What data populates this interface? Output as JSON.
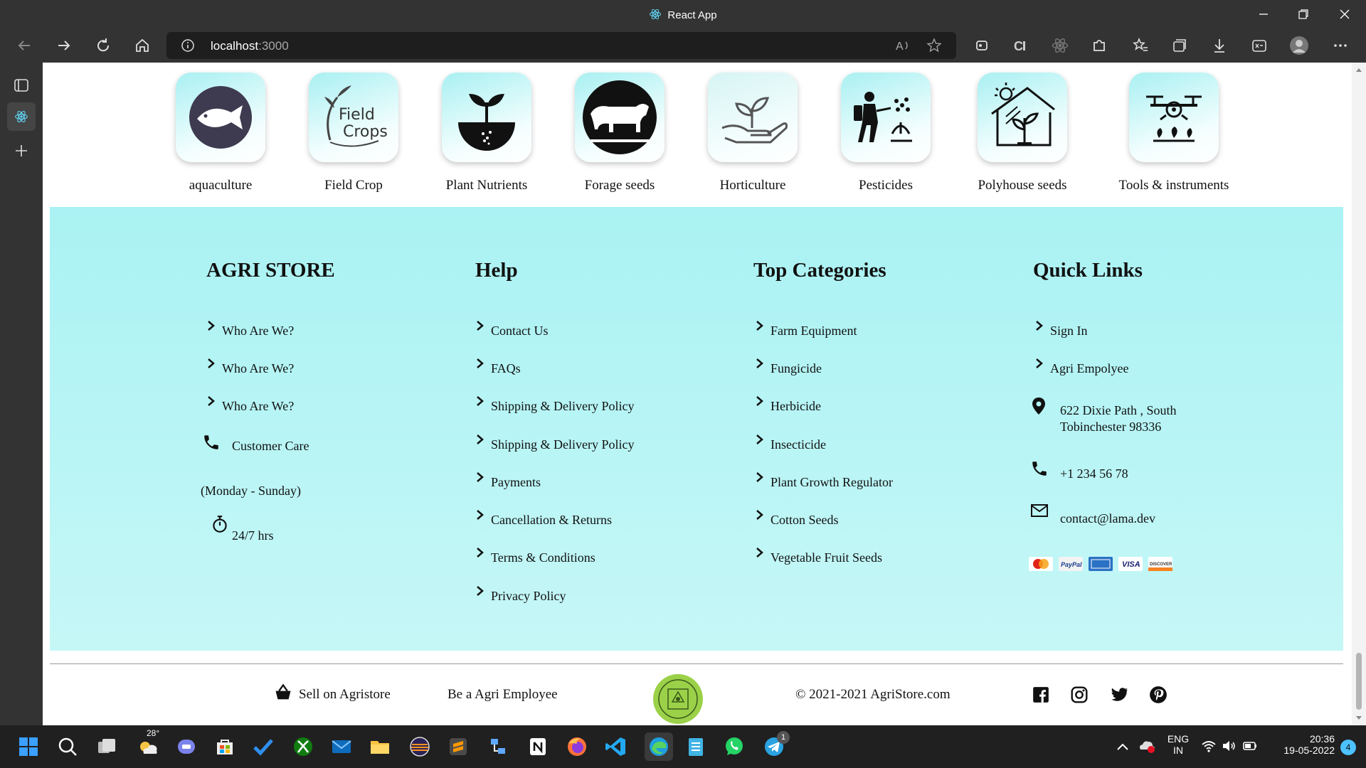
{
  "window": {
    "title": "React App"
  },
  "browser": {
    "url_host": "localhost",
    "url_port": ":3000",
    "nav": [
      "back-icon",
      "forward-icon",
      "refresh-icon",
      "home-icon"
    ]
  },
  "categories": [
    {
      "label": "aquaculture",
      "icon": "fish-icon"
    },
    {
      "label": "Field Crop",
      "icon": "field-crops-icon",
      "icon_text_1": "Field",
      "icon_text_2": "Crops"
    },
    {
      "label": "Plant Nutrients",
      "icon": "sprout-icon"
    },
    {
      "label": "Forage seeds",
      "icon": "cow-icon"
    },
    {
      "label": "Horticulture",
      "icon": "hand-plant-icon"
    },
    {
      "label": "Pesticides",
      "icon": "sprayer-icon"
    },
    {
      "label": "Polyhouse seeds",
      "icon": "greenhouse-icon"
    },
    {
      "label": "Tools & instruments",
      "icon": "drone-icon"
    }
  ],
  "footer": {
    "store": {
      "heading": "AGRI STORE",
      "links": [
        "Who Are We?",
        "Who Are We?",
        "Who Are We?"
      ],
      "customer_care": "Customer Care",
      "days": "(Monday - Sunday)",
      "hours": "24/7 hrs"
    },
    "help": {
      "heading": "Help",
      "links": [
        "Contact Us",
        "FAQs",
        "Shipping & Delivery Policy",
        "Shipping & Delivery Policy",
        "Payments",
        "Cancellation & Returns",
        "Terms & Conditions",
        "Privacy Policy"
      ]
    },
    "top_categories": {
      "heading": "Top Categories",
      "links": [
        "Farm Equipment",
        "Fungicide",
        "Herbicide",
        "Insecticide",
        "Plant Growth Regulator",
        "Cotton Seeds",
        "Vegetable Fruit Seeds"
      ]
    },
    "quick_links": {
      "heading": "Quick Links",
      "links": [
        "Sign In",
        "Agri Empolyee"
      ],
      "address_line1": "622 Dixie Path , South",
      "address_line2": "Tobinchester 98336",
      "phone": "+1 234 56 78",
      "email": "contact@lama.dev",
      "payments": [
        "MasterCard",
        "PayPal",
        "AMERICAN EXPRESS",
        "VISA",
        "DISCOVER"
      ]
    }
  },
  "bottom_bar": {
    "sell": "Sell on Agristore",
    "employee": "Be a Agri Employee",
    "copyright": "© 2021-2021 AgriStore.com",
    "social": [
      "facebook-icon",
      "instagram-icon",
      "twitter-icon",
      "pinterest-icon"
    ]
  },
  "taskbar": {
    "weather_temp": "28°",
    "lang_1": "ENG",
    "lang_2": "IN",
    "time": "20:36",
    "date": "19-05-2022",
    "notifications": "4",
    "telegram_badge": "1"
  },
  "colors": {
    "footer_bg_top": "#aaf2f3",
    "footer_bg_bottom": "#c6f7f7",
    "chrome": "#333333",
    "taskbar": "#202020"
  }
}
